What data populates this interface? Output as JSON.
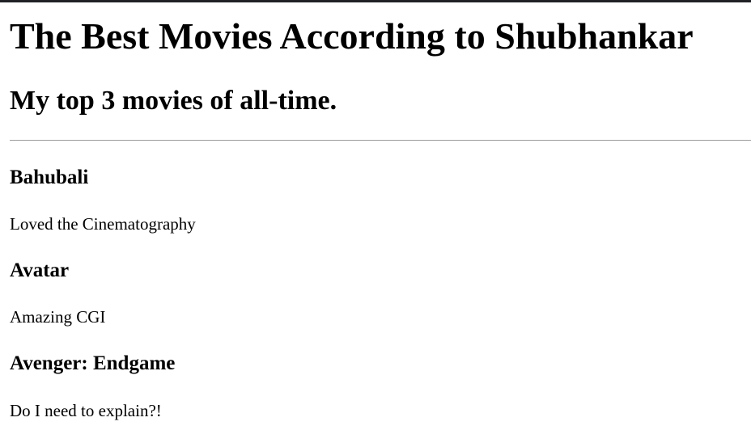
{
  "page": {
    "title": "The Best Movies According to Shubhankar",
    "subtitle": "My top 3 movies of all-time."
  },
  "movies": [
    {
      "title": "Bahubali",
      "description": "Loved the Cinematography"
    },
    {
      "title": "Avatar",
      "description": "Amazing CGI"
    },
    {
      "title": "Avenger: Endgame",
      "description": "Do I need to explain?!"
    }
  ]
}
